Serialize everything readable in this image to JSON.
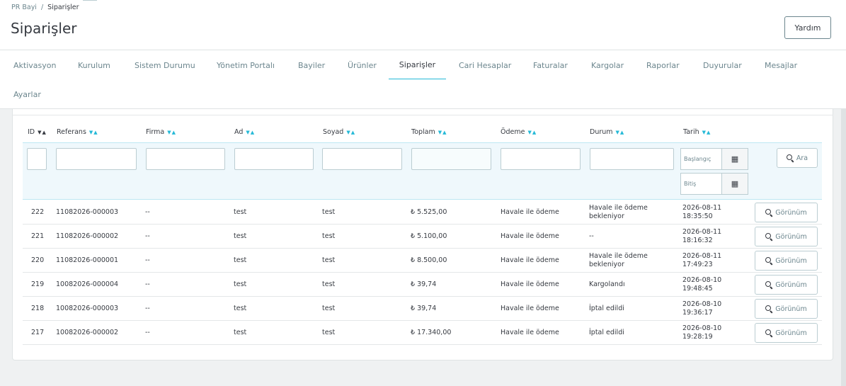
{
  "breadcrumb": {
    "parent": "PR Bayi",
    "separator": "/",
    "current": "Siparişler"
  },
  "page": {
    "title": "Siparişler",
    "help_label": "Yardım"
  },
  "tabs": [
    {
      "label": "Aktivasyon"
    },
    {
      "label": "Kurulum"
    },
    {
      "label": "Sistem Durumu"
    },
    {
      "label": "Yönetim Portalı"
    },
    {
      "label": "Bayiler"
    },
    {
      "label": "Ürünler"
    },
    {
      "label": "Siparişler",
      "active": true
    },
    {
      "label": "Cari Hesaplar"
    },
    {
      "label": "Faturalar"
    },
    {
      "label": "Kargolar"
    },
    {
      "label": "Raporlar"
    },
    {
      "label": "Duyurular"
    },
    {
      "label": "Mesajlar"
    },
    {
      "label": "Ayarlar"
    }
  ],
  "table": {
    "columns": [
      "ID",
      "Referans",
      "Firma",
      "Ad",
      "Soyad",
      "Toplam",
      "Ödeme",
      "Durum",
      "Tarih"
    ],
    "filters": {
      "date_start_placeholder": "Başlangıç",
      "date_end_placeholder": "Bitiş",
      "search_label": "Ara"
    },
    "view_label": "Görünüm",
    "rows": [
      {
        "id": "222",
        "ref": "11082026-000003",
        "firma": "--",
        "ad": "test",
        "soyad": "test",
        "toplam": "₺ 5.525,00",
        "odeme": "Havale ile ödeme",
        "durum1": "Havale ile ödeme",
        "durum2": "bekleniyor",
        "date": "2026-08-11",
        "time": "18:35:50"
      },
      {
        "id": "221",
        "ref": "11082026-000002",
        "firma": "--",
        "ad": "test",
        "soyad": "test",
        "toplam": "₺ 5.100,00",
        "odeme": "Havale ile ödeme",
        "durum1": "--",
        "durum2": "",
        "date": "2026-08-11",
        "time": "18:16:32"
      },
      {
        "id": "220",
        "ref": "11082026-000001",
        "firma": "--",
        "ad": "test",
        "soyad": "test",
        "toplam": "₺ 8.500,00",
        "odeme": "Havale ile ödeme",
        "durum1": "Havale ile ödeme",
        "durum2": "bekleniyor",
        "date": "2026-08-11",
        "time": "17:49:23"
      },
      {
        "id": "219",
        "ref": "10082026-000004",
        "firma": "--",
        "ad": "test",
        "soyad": "test",
        "toplam": "₺ 39,74",
        "odeme": "Havale ile ödeme",
        "durum1": "Kargolandı",
        "durum2": "",
        "date": "2026-08-10",
        "time": "19:48:45"
      },
      {
        "id": "218",
        "ref": "10082026-000003",
        "firma": "--",
        "ad": "test",
        "soyad": "test",
        "toplam": "₺ 39,74",
        "odeme": "Havale ile ödeme",
        "durum1": "İptal edildi",
        "durum2": "",
        "date": "2026-08-10",
        "time": "19:36:17"
      },
      {
        "id": "217",
        "ref": "10082026-000002",
        "firma": "--",
        "ad": "test",
        "soyad": "test",
        "toplam": "₺ 17.340,00",
        "odeme": "Havale ile ödeme",
        "durum1": "İptal edildi",
        "durum2": "",
        "date": "2026-08-10",
        "time": "19:28:19"
      }
    ]
  }
}
